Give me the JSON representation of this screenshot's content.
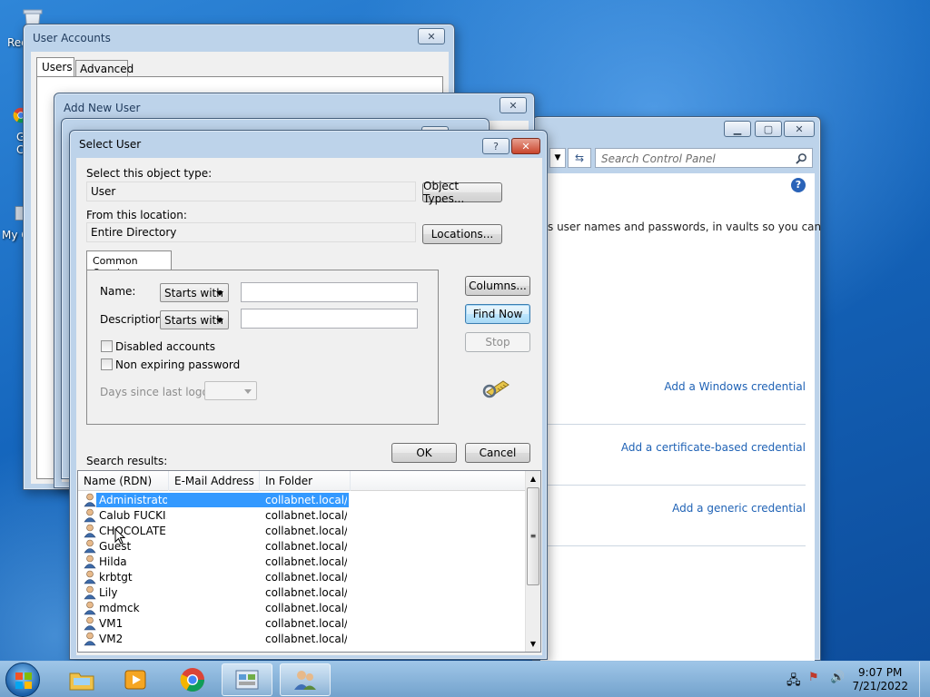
{
  "desktop": {
    "icons": [
      {
        "label": "Rec",
        "icon": "recycle-bin-icon"
      },
      {
        "label": "G\nC",
        "icon": "chrome-shortcut-icon"
      },
      {
        "label": "My C",
        "icon": "computer-icon"
      }
    ]
  },
  "user_accounts": {
    "title": "User Accounts",
    "tabs": [
      "Users",
      "Advanced"
    ]
  },
  "add_new_user": {
    "title": "Add New User"
  },
  "control_panel": {
    "search_placeholder": "Search Control Panel",
    "description": "s user names and passwords, in vaults so you can",
    "links": [
      "Add a Windows credential",
      "Add a certificate-based credential",
      "Add a generic credential"
    ]
  },
  "select_user": {
    "title": "Select User",
    "help_label": "?",
    "object_type_label": "Select this object type:",
    "object_type_value": "User",
    "object_types_button": "Object Types...",
    "location_label": "From this location:",
    "location_value": "Entire Directory",
    "locations_button": "Locations...",
    "tab_label": "Common Queries",
    "name_label": "Name:",
    "name_mode": "Starts with",
    "description_label": "Description:",
    "description_mode": "Starts with",
    "disabled_accounts": "Disabled accounts",
    "non_expiring": "Non expiring password",
    "days_since_label": "Days since last logon:",
    "columns_button": "Columns...",
    "find_now_button": "Find Now",
    "stop_button": "Stop",
    "ok_button": "OK",
    "cancel_button": "Cancel",
    "results_label": "Search results:",
    "columns": [
      "Name (RDN)",
      "E-Mail Address",
      "In Folder"
    ],
    "results": [
      {
        "name": "Administrator",
        "email": "",
        "folder": "collabnet.local/..."
      },
      {
        "name": "Calub FUCKI...",
        "email": "",
        "folder": "collabnet.local/..."
      },
      {
        "name": "CHOCOLATE...",
        "email": "",
        "folder": "collabnet.local/..."
      },
      {
        "name": "Guest",
        "email": "",
        "folder": "collabnet.local/..."
      },
      {
        "name": "Hilda",
        "email": "",
        "folder": "collabnet.local/..."
      },
      {
        "name": "krbtgt",
        "email": "",
        "folder": "collabnet.local/..."
      },
      {
        "name": "Lily",
        "email": "",
        "folder": "collabnet.local/..."
      },
      {
        "name": "mdmck",
        "email": "",
        "folder": "collabnet.local/..."
      },
      {
        "name": "VM1",
        "email": "",
        "folder": "collabnet.local/..."
      },
      {
        "name": "VM2",
        "email": "",
        "folder": "collabnet.local/..."
      }
    ]
  },
  "taskbar": {
    "time": "9:07 PM",
    "date": "7/21/2022"
  }
}
